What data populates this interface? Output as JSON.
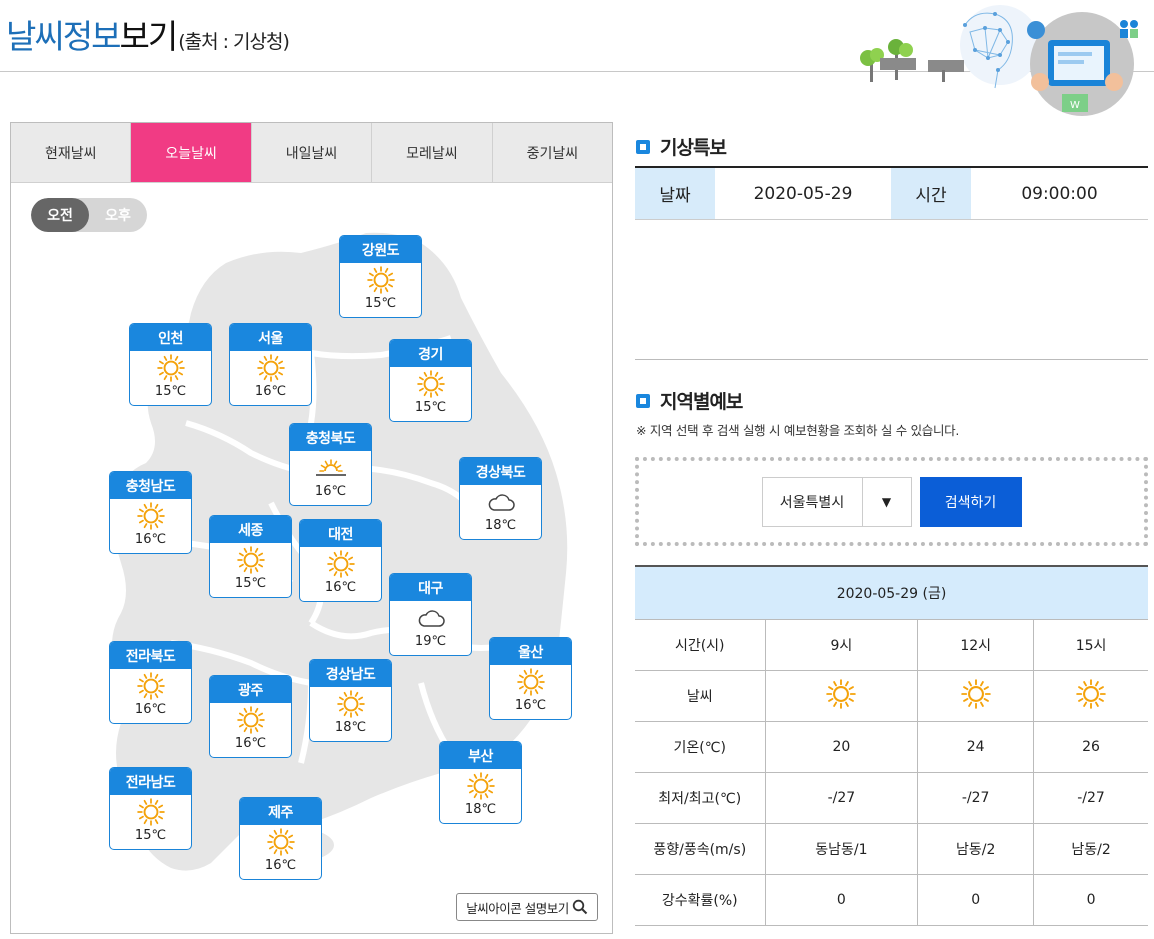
{
  "header": {
    "title_part1": "날씨정보",
    "title_part2": "보기",
    "source": "(출처 : 기상청)"
  },
  "tabs": [
    "현재날씨",
    "오늘날씨",
    "내일날씨",
    "모레날씨",
    "중기날씨"
  ],
  "active_tab": "오늘날씨",
  "ampm": {
    "am": "오전",
    "pm": "오후",
    "selected": "오전"
  },
  "cities": [
    {
      "name": "강원도",
      "icon": "sun-icon",
      "temp": "15℃"
    },
    {
      "name": "인천",
      "icon": "sun-icon",
      "temp": "15℃"
    },
    {
      "name": "서울",
      "icon": "sun-icon",
      "temp": "16℃"
    },
    {
      "name": "경기",
      "icon": "sun-icon",
      "temp": "15℃"
    },
    {
      "name": "충청북도",
      "icon": "sunrise-icon",
      "temp": "16℃"
    },
    {
      "name": "경상북도",
      "icon": "cloud-icon",
      "temp": "18℃"
    },
    {
      "name": "충청남도",
      "icon": "sun-icon",
      "temp": "16℃"
    },
    {
      "name": "세종",
      "icon": "sun-icon",
      "temp": "15℃"
    },
    {
      "name": "대전",
      "icon": "sun-icon",
      "temp": "16℃"
    },
    {
      "name": "대구",
      "icon": "cloud-icon",
      "temp": "19℃"
    },
    {
      "name": "전라북도",
      "icon": "sun-icon",
      "temp": "16℃"
    },
    {
      "name": "울산",
      "icon": "sun-icon",
      "temp": "16℃"
    },
    {
      "name": "광주",
      "icon": "sun-icon",
      "temp": "16℃"
    },
    {
      "name": "경상남도",
      "icon": "sun-icon",
      "temp": "18℃"
    },
    {
      "name": "부산",
      "icon": "sun-icon",
      "temp": "18℃"
    },
    {
      "name": "전라남도",
      "icon": "sun-icon",
      "temp": "15℃"
    },
    {
      "name": "제주",
      "icon": "sun-icon",
      "temp": "16℃"
    }
  ],
  "legend_button": "날씨아이콘 설명보기",
  "alert": {
    "heading": "기상특보",
    "date_label": "날짜",
    "date_value": "2020-05-29",
    "time_label": "시간",
    "time_value": "09:00:00"
  },
  "regional": {
    "heading": "지역별예보",
    "description": "※ 지역 선택 후 검색 실행 시 예보현황을 조회하 실 수 있습니다.",
    "selected_region": "서울특별시",
    "search_button": "검색하기"
  },
  "forecast": {
    "date": "2020-05-29 (금)",
    "rows": [
      {
        "label": "시간(시)",
        "values": [
          "9시",
          "12시",
          "15시"
        ]
      },
      {
        "label": "날씨",
        "icons": [
          "sun-icon",
          "sun-icon",
          "sun-icon"
        ]
      },
      {
        "label": "기온(℃)",
        "values": [
          "20",
          "24",
          "26"
        ]
      },
      {
        "label": "최저/최고(℃)",
        "values": [
          "-/27",
          "-/27",
          "-/27"
        ]
      },
      {
        "label": "풍향/풍속(m/s)",
        "values": [
          "동남동/1",
          "남동/2",
          "남동/2"
        ]
      },
      {
        "label": "강수확률(%)",
        "values": [
          "0",
          "0",
          "0"
        ]
      }
    ]
  },
  "colors": {
    "brand_blue": "#1d6fb8",
    "tab_active": "#f13b84",
    "city_header": "#1a87de",
    "search_button": "#0b5ed7",
    "label_bg": "#d7ebfa",
    "sun": "#f4a20a"
  }
}
